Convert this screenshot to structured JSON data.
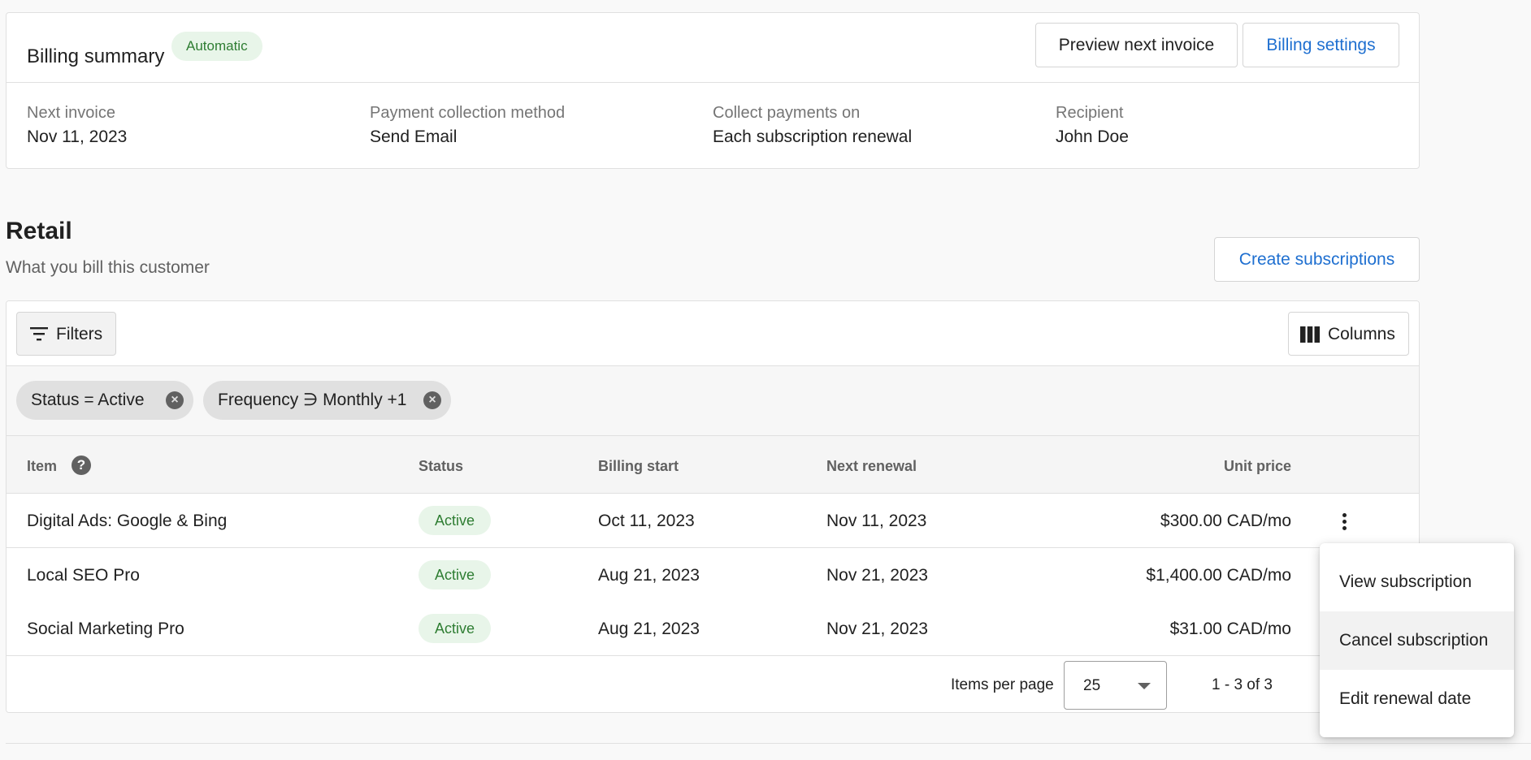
{
  "billing_summary": {
    "title": "Billing summary",
    "badge": "Automatic",
    "preview_label": "Preview next invoice",
    "settings_label": "Billing settings",
    "fields": [
      {
        "label": "Next invoice",
        "value": "Nov 11, 2023"
      },
      {
        "label": "Payment collection method",
        "value": "Send Email"
      },
      {
        "label": "Collect payments on",
        "value": "Each subscription renewal"
      },
      {
        "label": "Recipient",
        "value": "John Doe"
      }
    ]
  },
  "retail": {
    "title": "Retail",
    "subtitle": "What you bill this customer",
    "create_label": "Create subscriptions"
  },
  "toolbar": {
    "filters_label": "Filters",
    "columns_label": "Columns"
  },
  "chips": [
    {
      "label": "Status = Active"
    },
    {
      "label": "Frequency ∋ Monthly +1"
    }
  ],
  "table": {
    "headers": {
      "item": "Item",
      "status": "Status",
      "billing_start": "Billing start",
      "next_renewal": "Next renewal",
      "unit_price": "Unit price"
    },
    "rows": [
      {
        "item": "Digital Ads: Google & Bing",
        "status": "Active",
        "billing_start": "Oct 11, 2023",
        "next_renewal": "Nov 11, 2023",
        "unit_price": "$300.00 CAD/mo"
      },
      {
        "item": "Local SEO Pro",
        "status": "Active",
        "billing_start": "Aug 21, 2023",
        "next_renewal": "Nov 21, 2023",
        "unit_price": "$1,400.00 CAD/mo"
      },
      {
        "item": "Social Marketing Pro",
        "status": "Active",
        "billing_start": "Aug 21, 2023",
        "next_renewal": "Nov 21, 2023",
        "unit_price": "$31.00 CAD/mo"
      }
    ]
  },
  "pagination": {
    "items_per_page_label": "Items per page",
    "items_per_page_value": "25",
    "range": "1 - 3 of 3"
  },
  "menu": {
    "items": [
      {
        "label": "View subscription"
      },
      {
        "label": "Cancel subscription"
      },
      {
        "label": "Edit renewal date"
      }
    ]
  },
  "colors": {
    "accent_blue": "#1e6fd0",
    "active_green": "#2e7d32",
    "active_bg": "#e8f5e9"
  }
}
